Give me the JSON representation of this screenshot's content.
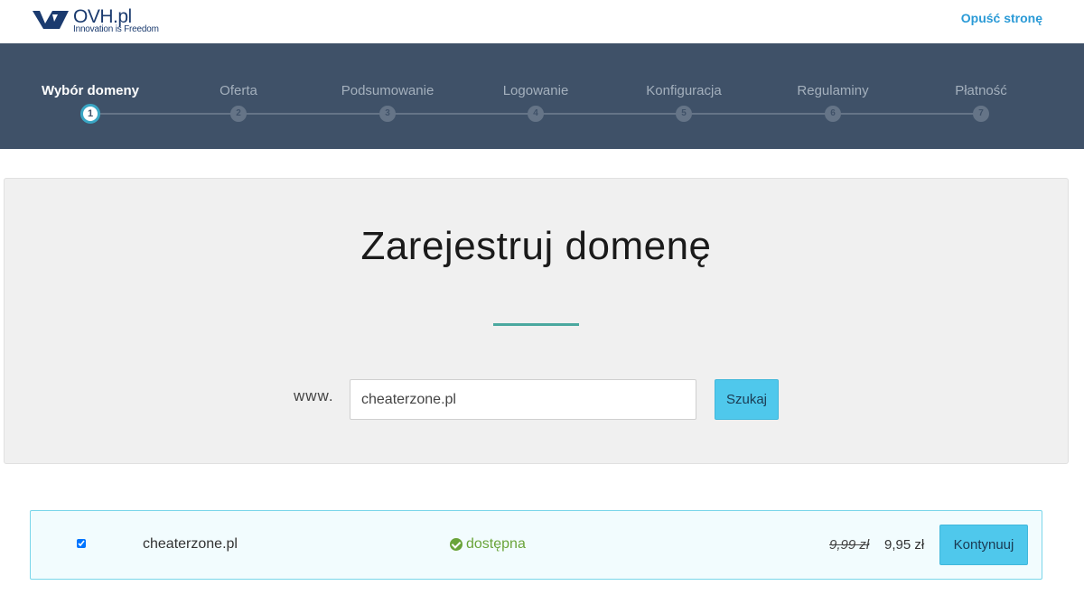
{
  "header": {
    "logo_name": "OVH",
    "logo_suffix": ".pl",
    "logo_tagline": "Innovation is Freedom",
    "leave_link": "Opuść stronę"
  },
  "stepper": {
    "steps": [
      {
        "label": "Wybór domeny",
        "number": "1"
      },
      {
        "label": "Oferta",
        "number": "2"
      },
      {
        "label": "Podsumowanie",
        "number": "3"
      },
      {
        "label": "Logowanie",
        "number": "4"
      },
      {
        "label": "Konfiguracja",
        "number": "5"
      },
      {
        "label": "Regulaminy",
        "number": "6"
      },
      {
        "label": "Płatność",
        "number": "7"
      }
    ],
    "active_step": 1
  },
  "hero": {
    "title": "Zarejestruj domenę",
    "www_label": "www.",
    "search_value": "cheaterzone.pl",
    "search_button": "Szukaj"
  },
  "result": {
    "domain": "cheaterzone.pl",
    "status": "dostępna",
    "old_price": "9,99 zł",
    "new_price": "9,95 zł",
    "continue_button": "Kontynuuj",
    "checked": true
  },
  "colors": {
    "stepper_bg": "#3f5168",
    "accent_blue": "#4fc8ec",
    "link_blue": "#2a9ad6",
    "available_green": "#6aa43a",
    "hero_rule": "#4aa89f"
  }
}
